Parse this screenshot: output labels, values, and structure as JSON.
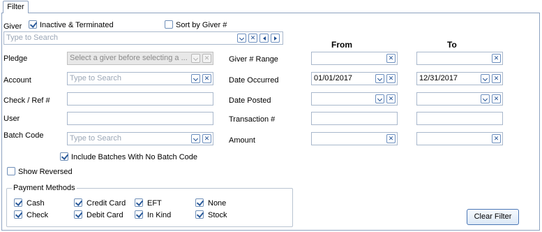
{
  "tab": {
    "label": "Filter"
  },
  "giver": {
    "label": "Giver",
    "inactive_label": "Inactive & Terminated",
    "sort_label": "Sort by Giver #",
    "search_placeholder": "Type to Search"
  },
  "pledge": {
    "label": "Pledge",
    "placeholder": "Select a giver before selecting a ..."
  },
  "account": {
    "label": "Account",
    "placeholder": "Type to Search"
  },
  "check_ref": {
    "label": "Check / Ref #",
    "value": ""
  },
  "user": {
    "label": "User",
    "value": ""
  },
  "batch": {
    "label": "Batch Code",
    "placeholder": "Type to Search",
    "include_label": "Include Batches With No Batch Code"
  },
  "show_reversed": {
    "label": "Show Reversed"
  },
  "range": {
    "from_header": "From",
    "to_header": "To",
    "giver_range_label": "Giver # Range",
    "date_occurred_label": "Date Occurred",
    "date_occurred_from": "01/01/2017",
    "date_occurred_to": "12/31/2017",
    "date_posted_label": "Date Posted",
    "transaction_label": "Transaction #",
    "amount_label": "Amount"
  },
  "payment_methods": {
    "title": "Payment Methods",
    "items": [
      "Cash",
      "Check",
      "Credit Card",
      "Debit Card",
      "EFT",
      "In Kind",
      "None",
      "Stock"
    ]
  },
  "clear_button": {
    "label": "Clear Filter"
  }
}
